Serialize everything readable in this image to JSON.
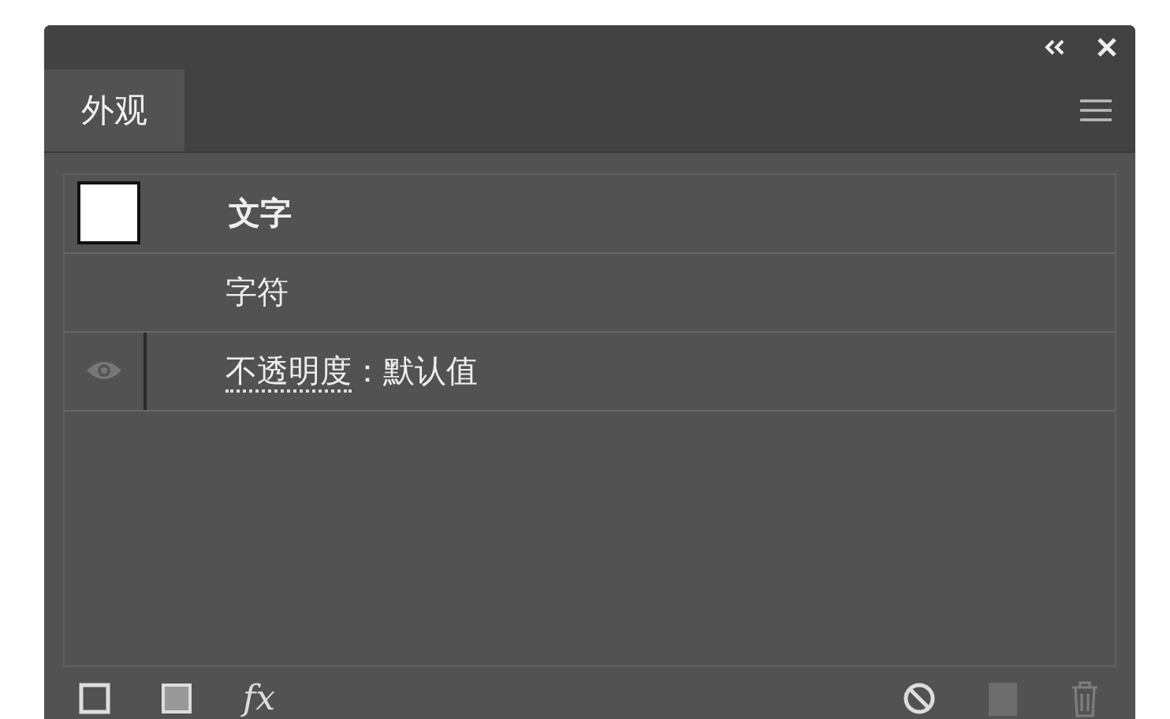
{
  "panel": {
    "tabs": [
      {
        "label": "外观",
        "selected": true
      }
    ]
  },
  "rows": [
    {
      "kind": "fill",
      "label": "文字",
      "bold": true
    },
    {
      "kind": "plain",
      "label": "字符",
      "bold": false
    },
    {
      "kind": "opacity",
      "link": "不透明度",
      "value": "：默认值",
      "visible": true
    }
  ],
  "toolbar": {
    "fx": "fx"
  }
}
